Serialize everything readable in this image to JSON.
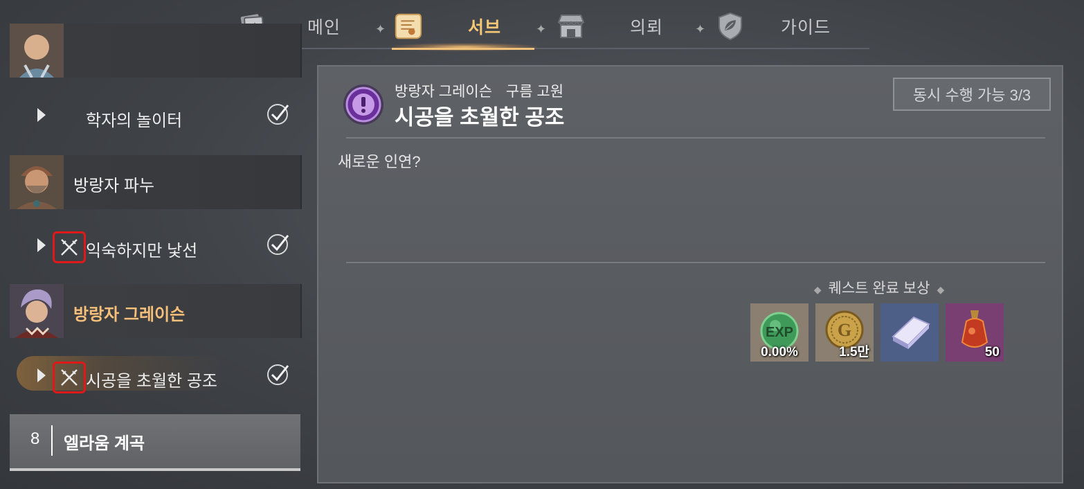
{
  "tabs": [
    {
      "label": "메인",
      "icon": "book-star-icon",
      "active": false
    },
    {
      "label": "서브",
      "icon": "scroll-icon",
      "active": true
    },
    {
      "label": "의뢰",
      "icon": "shop-icon",
      "active": false
    },
    {
      "label": "가이드",
      "icon": "shield-leaf-icon",
      "active": false
    }
  ],
  "sidebar": {
    "q_scholar": {
      "label": "학자의 놀이터",
      "completed_icon": "check-circle-icon"
    },
    "npc_panu": {
      "name": "방랑자 파누"
    },
    "q_familiar": {
      "label": "익숙하지만 낯선",
      "icon": "crossed-swords-icon"
    },
    "npc_grace": {
      "name": "방랑자 그레이슨"
    },
    "q_time": {
      "label": "시공을 초월한 공조",
      "icon": "crossed-swords-icon"
    },
    "region": {
      "number": "8",
      "name": "엘라움 계곡"
    }
  },
  "detail": {
    "npc": "방랑자 그레이슨",
    "location": "구름 고원",
    "title": "시공을 초월한 공조",
    "concurrent": "동시 수행 가능 3/3",
    "description": "새로운 인연?",
    "reward_header": "퀘스트 완료 보상",
    "rewards": [
      {
        "icon": "exp-orb-icon",
        "qty": "0.00%"
      },
      {
        "icon": "gold-coin-icon",
        "qty": "1.5만"
      },
      {
        "icon": "crystal-ingot-icon",
        "qty": ""
      },
      {
        "icon": "red-potion-icon",
        "qty": "50"
      }
    ]
  },
  "colors": {
    "active_tab": "#f5c877",
    "active_npc": "#f7c07a",
    "highlight_box": "#e01818",
    "quest_icon": "#6a2f9a"
  }
}
